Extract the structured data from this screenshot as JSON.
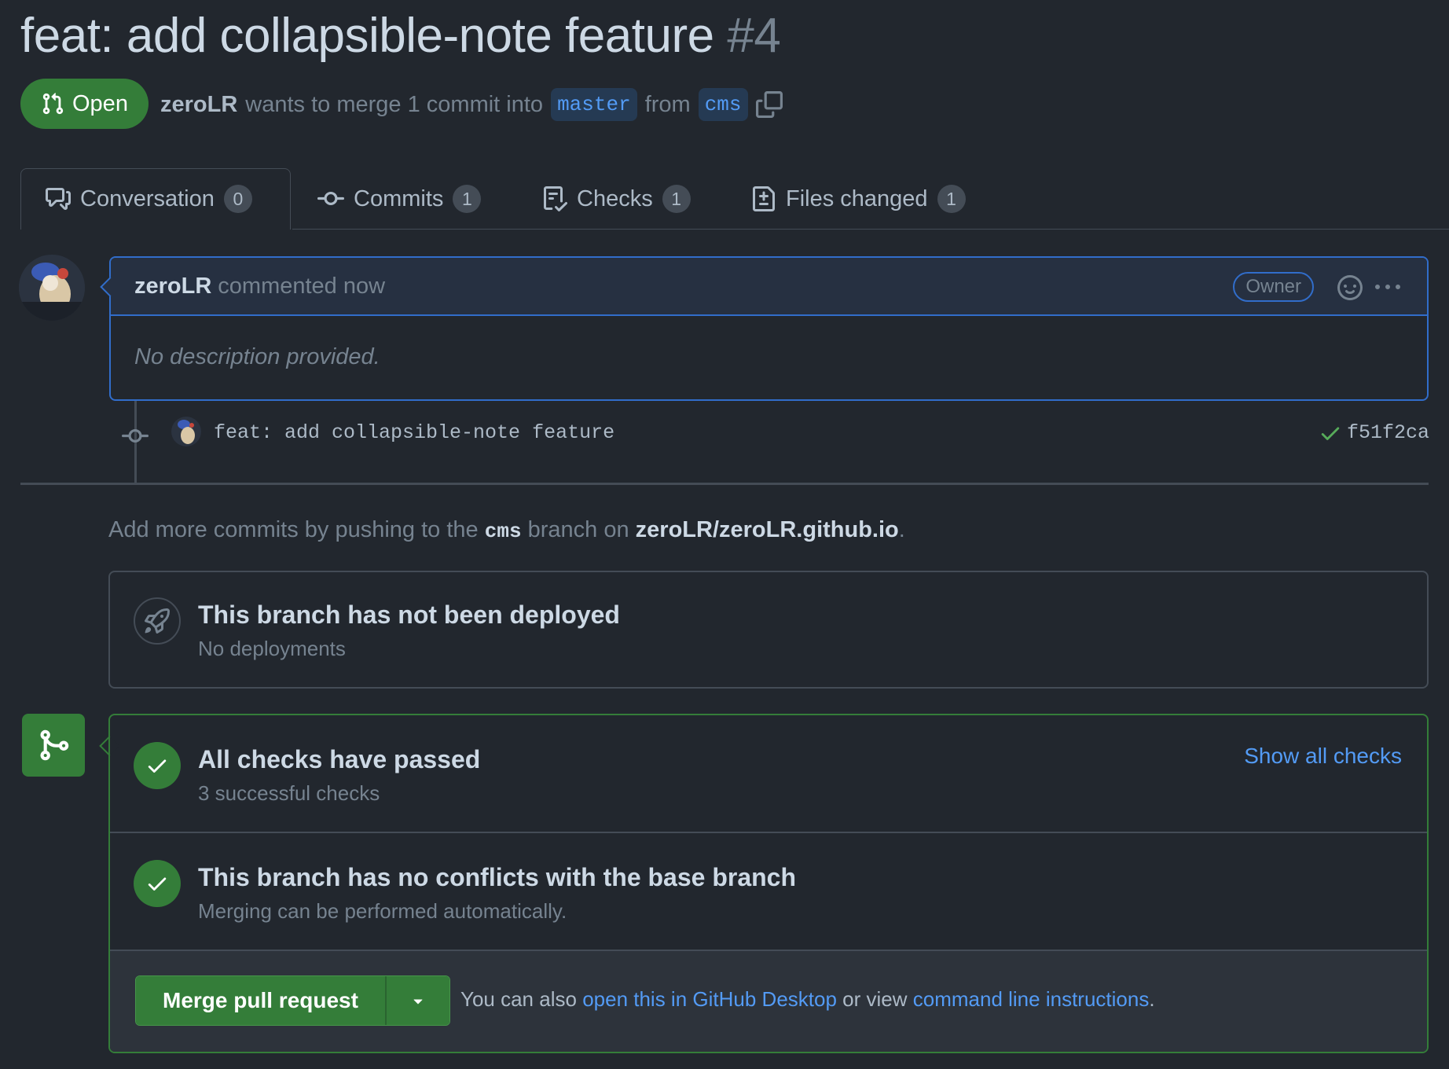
{
  "pr": {
    "title": "feat: add collapsible-note feature",
    "number": "#4",
    "state": "Open",
    "author": "zeroLR",
    "merge_text": "wants to merge 1 commit into",
    "base_branch": "master",
    "from_text": "from",
    "head_branch": "cms"
  },
  "tabs": [
    {
      "label": "Conversation",
      "count": "0",
      "icon": "comment-discussion-icon"
    },
    {
      "label": "Commits",
      "count": "1",
      "icon": "git-commit-icon"
    },
    {
      "label": "Checks",
      "count": "1",
      "icon": "checklist-icon"
    },
    {
      "label": "Files changed",
      "count": "1",
      "icon": "file-diff-icon"
    }
  ],
  "comment": {
    "author": "zeroLR",
    "action": "commented now",
    "badge": "Owner",
    "body": "No description provided."
  },
  "commit": {
    "message": "feat: add collapsible-note feature",
    "sha": "f51f2ca"
  },
  "hint": {
    "prefix": "Add more commits by pushing to the",
    "branch": "cms",
    "middle": "branch on",
    "repo": "zeroLR/zeroLR.github.io",
    "suffix": "."
  },
  "deploy": {
    "title": "This branch has not been deployed",
    "subtitle": "No deployments"
  },
  "checks": {
    "title": "All checks have passed",
    "subtitle": "3 successful checks",
    "link": "Show all checks"
  },
  "conflicts": {
    "title": "This branch has no conflicts with the base branch",
    "subtitle": "Merging can be performed automatically."
  },
  "merge": {
    "button": "Merge pull request",
    "text_prefix": "You can also",
    "desktop_link": "open this in GitHub Desktop",
    "text_middle": "or view",
    "cli_link": "command line instructions",
    "text_suffix": "."
  },
  "colors": {
    "background": "#22272e",
    "accent_blue": "#539bf5",
    "success_green": "#347d39",
    "border": "#444c56"
  }
}
